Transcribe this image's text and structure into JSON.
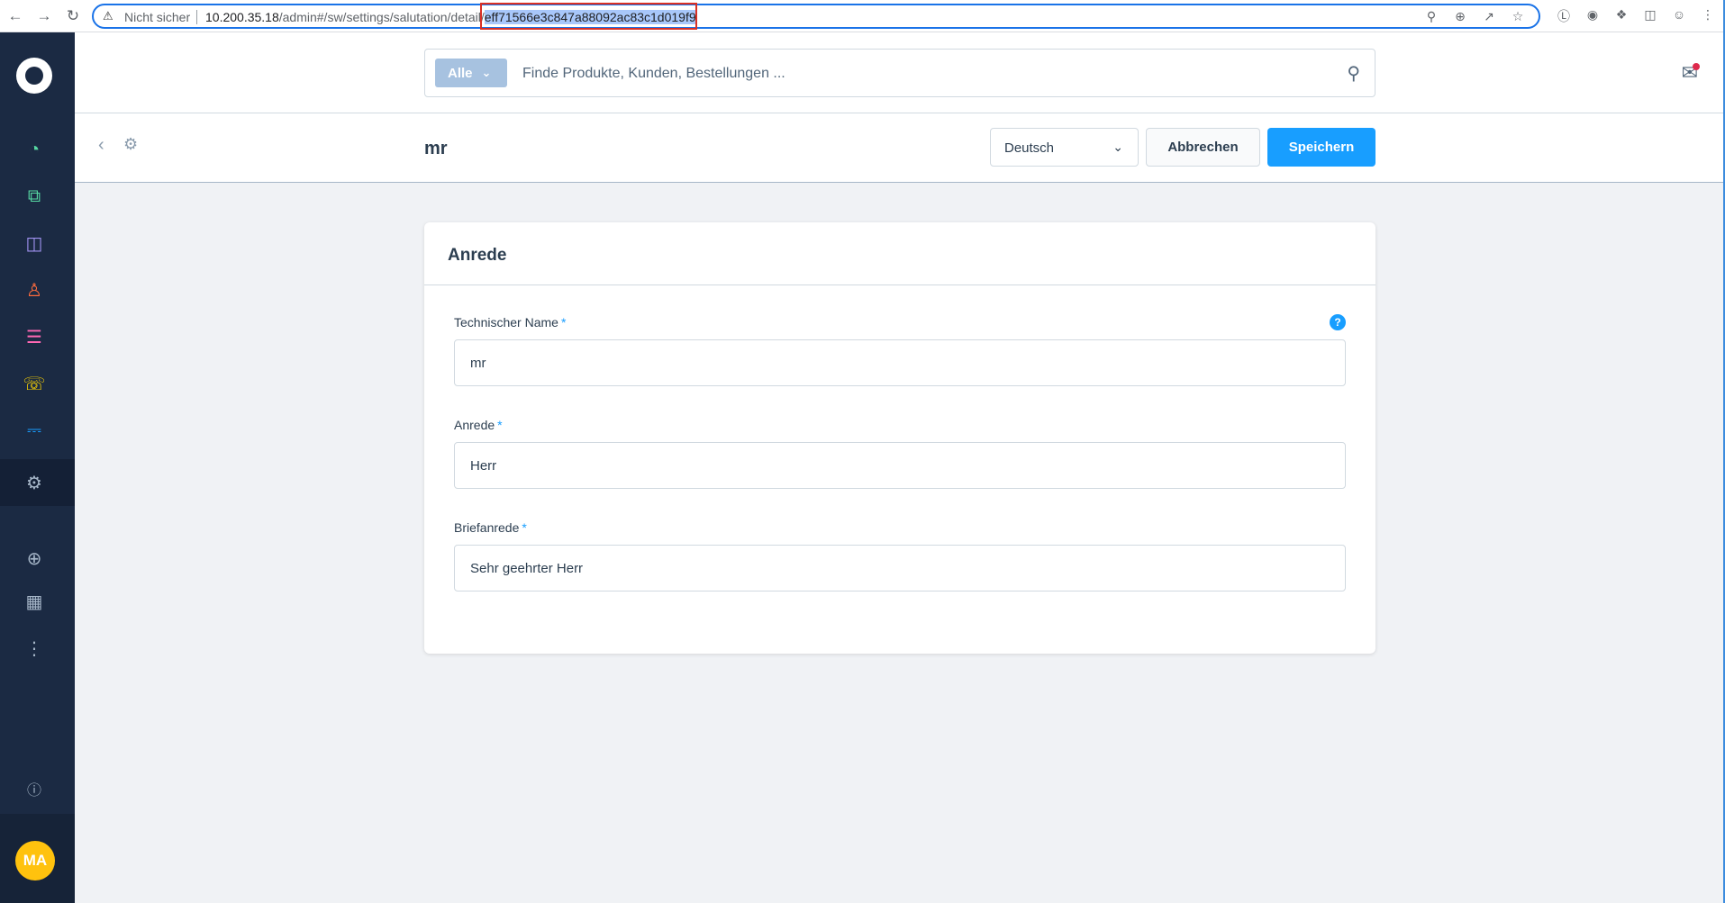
{
  "browser": {
    "security_label": "Nicht sicher",
    "url_host": "10.200.35.18",
    "url_path": "/admin#/sw/settings/salutation/detail/",
    "url_id": "eff71566e3c847a88092ac83c1d019f9"
  },
  "sidebar": {
    "avatar_initials": "MA",
    "icon_colors": {
      "dashboard": "#57d9a3",
      "catalogues": "#57d9a3",
      "orders": "#a092f0",
      "customers": "#ff6b3d",
      "content": "#ff68b4",
      "marketing": "#ffd700",
      "extensions": "#189eff",
      "settings": "#a6b6c8"
    }
  },
  "search": {
    "scope_label": "Alle",
    "placeholder": "Finde Produkte, Kunden, Bestellungen ..."
  },
  "smartbar": {
    "title": "mr",
    "language": "Deutsch",
    "cancel_label": "Abbrechen",
    "save_label": "Speichern"
  },
  "card": {
    "title": "Anrede",
    "fields": [
      {
        "label": "Technischer Name",
        "required": "*",
        "value": "mr"
      },
      {
        "label": "Anrede",
        "required": "*",
        "value": "Herr"
      },
      {
        "label": "Briefanrede",
        "required": "*",
        "value": "Sehr geehrter Herr"
      }
    ],
    "help_symbol": "?"
  }
}
